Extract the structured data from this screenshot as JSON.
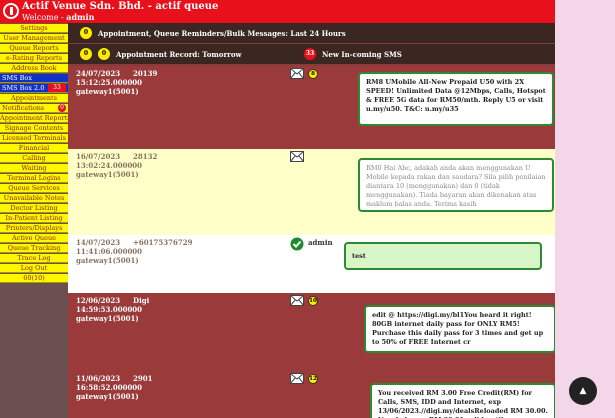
{
  "app": {
    "title": "Actif Venue Sdn. Bhd. - actif queue",
    "welcome_prefix": "Welcome - ",
    "welcome_user": "admin"
  },
  "colors": {
    "header_red": "#e8101a",
    "menu_yellow": "#fff700",
    "menu_text": "#8a1f0f",
    "sms_blue": "#1033c6",
    "bubble_border": "#2e8a2e"
  },
  "sidebar": {
    "items": [
      {
        "label": "Settings"
      },
      {
        "label": "User Management"
      },
      {
        "label": "Queue Reports"
      },
      {
        "label": "e-Rating Reports"
      },
      {
        "label": "Address Book"
      },
      {
        "label": "SMS Box"
      },
      {
        "label": "SMS Box 2.0",
        "badge": "33"
      },
      {
        "label": "Appointments"
      },
      {
        "label": "Notifications",
        "badge": "0"
      },
      {
        "label": "Appointment Reports"
      },
      {
        "label": "Signage Contents"
      },
      {
        "label": "Licensed Terminals"
      },
      {
        "label": "Financial"
      },
      {
        "label": "Calling"
      },
      {
        "label": "Waiting"
      },
      {
        "label": "Terminal Logins"
      },
      {
        "label": "Queue Services"
      },
      {
        "label": "Unavailable Notes"
      },
      {
        "label": "Doctor Listing"
      },
      {
        "label": "In-Patient Listing"
      },
      {
        "label": "Printers/Displays"
      },
      {
        "label": "Active Queue"
      },
      {
        "label": "Queue Tracking"
      },
      {
        "label": "Trace Log"
      },
      {
        "label": "Log Out"
      },
      {
        "label": "60(10)"
      }
    ]
  },
  "strips": {
    "top": {
      "badge": "0",
      "label": "Appointment, Queue Reminders/Bulk Messages: Last 24 Hours"
    },
    "second": {
      "badge1": "0",
      "badge2": "0",
      "label": "Appointment Record: Tomorrow",
      "sms_badge": "33",
      "sms_label": "New In-coming SMS"
    }
  },
  "messages": [
    {
      "date": "24/07/2023",
      "time": "15:12:25.000000",
      "gateway": "gateway1(5001)",
      "number": "20139",
      "badge": "8",
      "text": "RM8 UMobile All-New Prepaid U50 with 2X SPEED! Unlimited Data @12Mbps, Calls, Hotspot & FREE 5G data for RM50/mth. Reply U5 or visit u.my/u50. T&C: u.my/u35"
    },
    {
      "date": "16/07/2023",
      "time": "13:02:24.000000",
      "gateway": "gateway1(5001)",
      "number": "28132",
      "text": "RM0 Hai Abc, adakah anda akan menggunakan U Mobile kepada rakan dan saudara? Sila pilih penilaian diantara 10 (menggunakan) dan 0 (tidak menggunakan). Tiada bayaran akan dikenakan atas maklum balas anda. Terima kasih"
    },
    {
      "date": "14/07/2023",
      "time": "11:41:06.000000",
      "gateway": "gateway1(5001)",
      "number": "+60175376729",
      "user": "admin",
      "text": "test"
    },
    {
      "date": "12/06/2023",
      "time": "14:59:53.000000",
      "gateway": "gateway1(5001)",
      "number": "Digi",
      "badge": "10",
      "text": "edit @ https://digi.my/bl1You heard it right! 80GB internet daily pass for ONLY RM5! Purchase this daily pass for 3 times and get up to 50% of FREE Internet cr"
    },
    {
      "date": "11/06/2023",
      "time": "16:58:52.000000",
      "gateway": "gateway1(5001)",
      "number": "2901",
      "badge": "12",
      "text": "You received RM 3.00 Free Credit(RM) for Calls, SMS, IDD and Internet, exp 13/06/2023.//digi.my/dealsReloaded RM 30.00. New balance: RM 29.01 valid until 11/07/2023. Get the best"
    }
  ]
}
